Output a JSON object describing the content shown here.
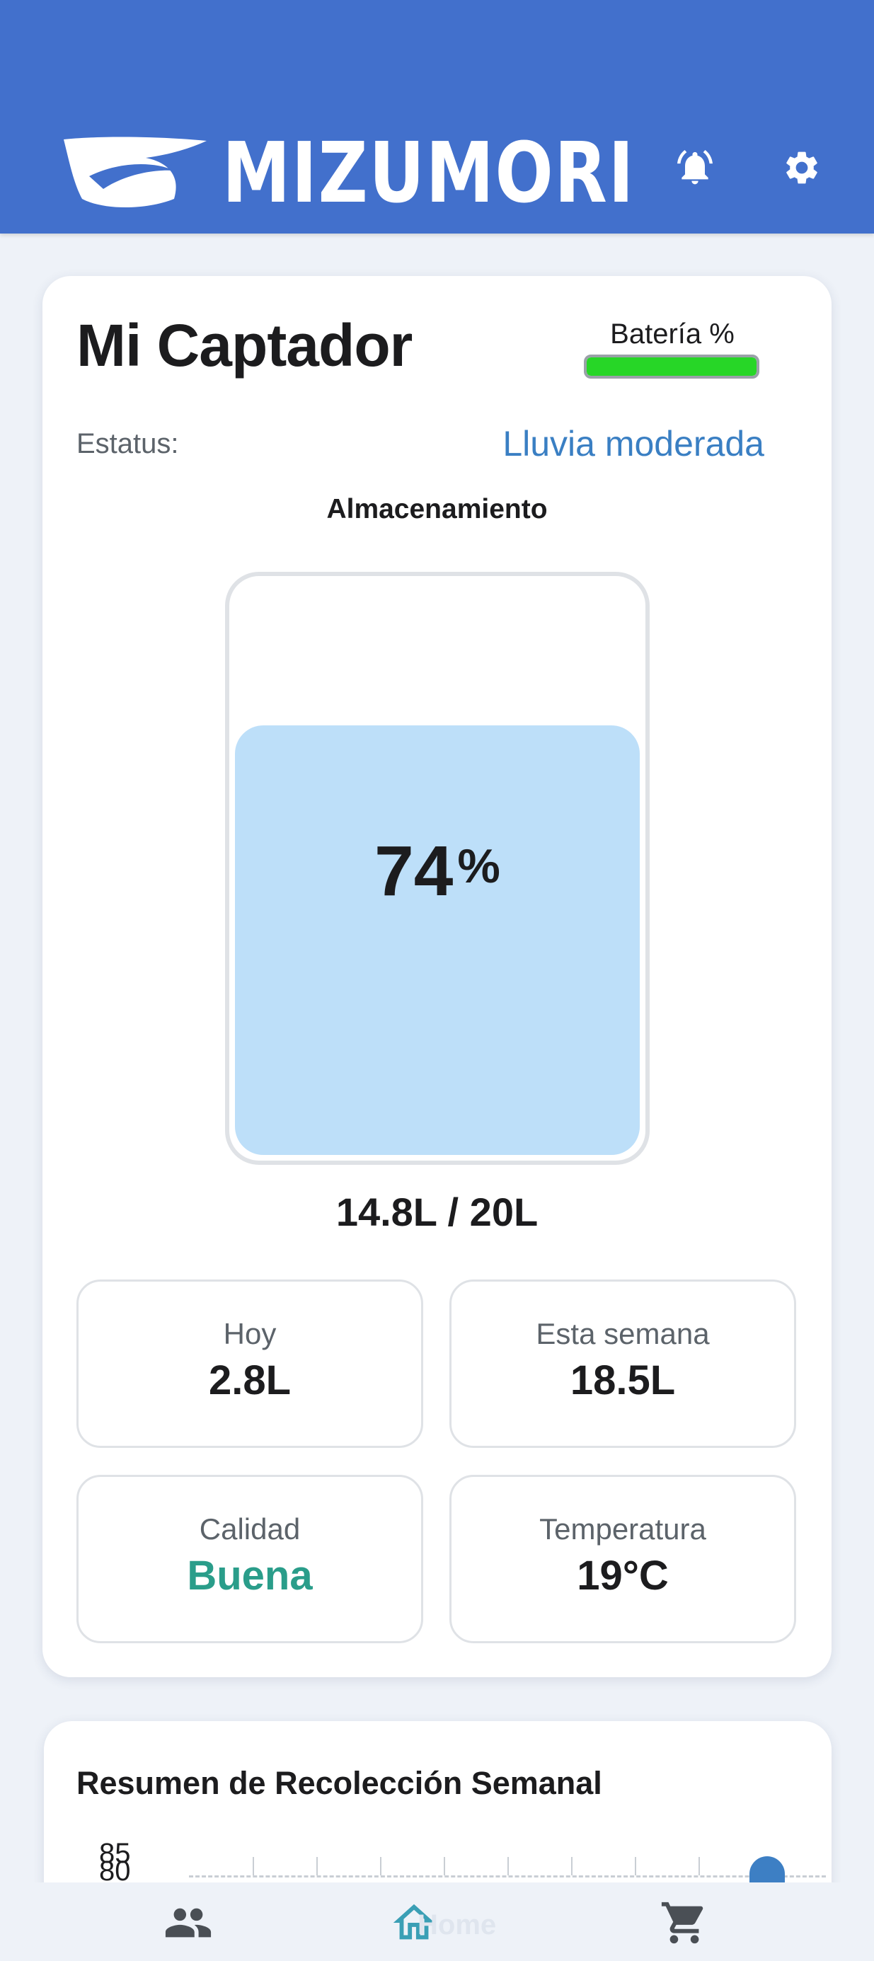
{
  "header": {
    "brand": "MIZUMORI",
    "icons": [
      "bell-icon",
      "gear-icon"
    ],
    "color": "#4270cc"
  },
  "collector": {
    "title": "Mi Captador",
    "battery_label": "Batería %",
    "battery_level": 1.0,
    "battery_color": "#27d627",
    "status_label": "Estatus:",
    "status_value": "Lluvia moderada",
    "storage_label": "Almacenamiento",
    "fill_percent": "74",
    "percent_symbol": "%",
    "capacity_text": "14.8L / 20L"
  },
  "stats": [
    {
      "label": "Hoy",
      "value": "2.8L"
    },
    {
      "label": "Esta semana",
      "value": "18.5L"
    },
    {
      "label": "Calidad",
      "value": "Buena"
    },
    {
      "label": "Temperatura",
      "value": "19°C"
    }
  ],
  "weekly": {
    "title": "Resumen de Recolección Semanal",
    "ticks": [
      "85",
      "80"
    ]
  },
  "nav": {
    "items": [
      "people-icon",
      "home-icon",
      "cart-icon"
    ],
    "home_label": "Home"
  }
}
